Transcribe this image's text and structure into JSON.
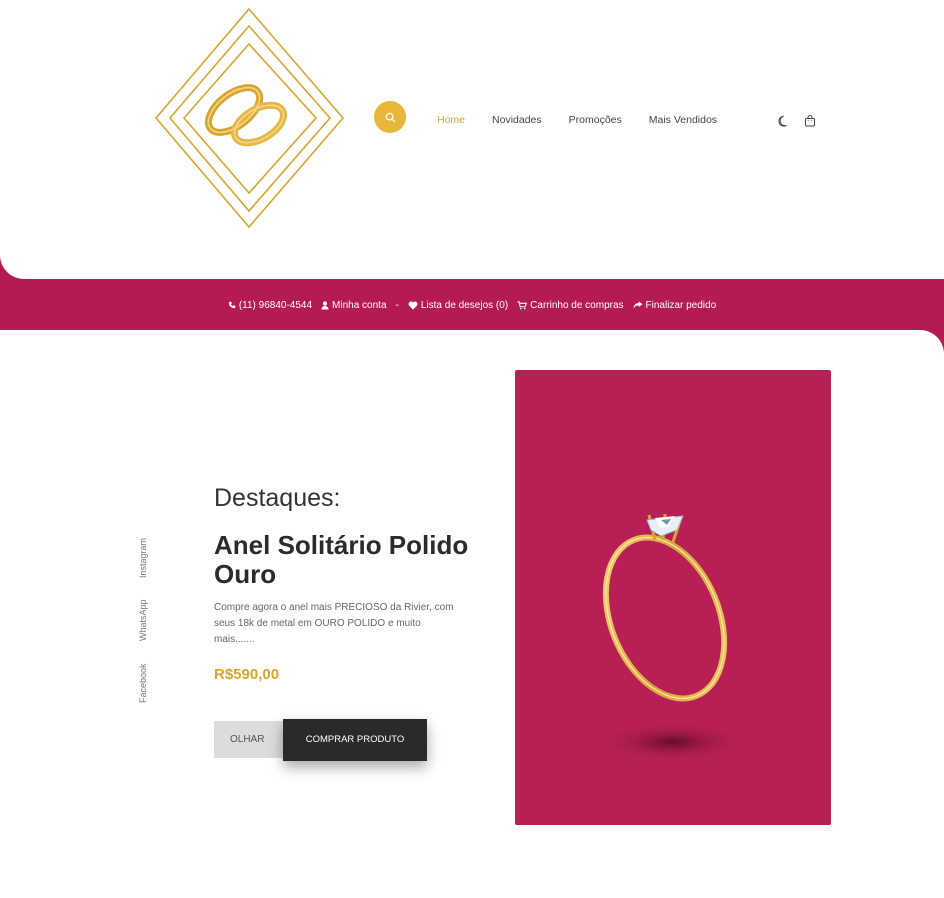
{
  "brand": {
    "accent": "#d4a72c",
    "primary": "#b51b52",
    "dark": "#2a2a2a"
  },
  "header": {
    "logo_icon": "wedding-rings-logo",
    "search_icon": "search-icon",
    "nav": [
      {
        "label": "Home",
        "active": true
      },
      {
        "label": "Novidades",
        "active": false
      },
      {
        "label": "Promoções",
        "active": false
      },
      {
        "label": "Mais Vendidos",
        "active": false
      }
    ],
    "icons": [
      "moon-icon",
      "shopping-bag-icon"
    ]
  },
  "topbar": {
    "phone": "(11) 96840-4544",
    "account": "Minha conta",
    "account_sep": "-",
    "wishlist": "Lista de desejos (0)",
    "cart": "Carrinho de compras",
    "checkout": "Finalizar pedido"
  },
  "social": [
    "Instagram",
    "WhatsApp",
    "Facebook"
  ],
  "hero": {
    "kicker": "Destaques:",
    "title": "Anel Solitário Polido Ouro",
    "description": "Compre agora o anel mais PRECIOSO da Rivier, com seus 18k de metal em OURO POLIDO e muito mais.......",
    "price": "R$590,00",
    "btn_look": "OLHAR",
    "btn_buy": "COMPRAR PRODUTO"
  }
}
